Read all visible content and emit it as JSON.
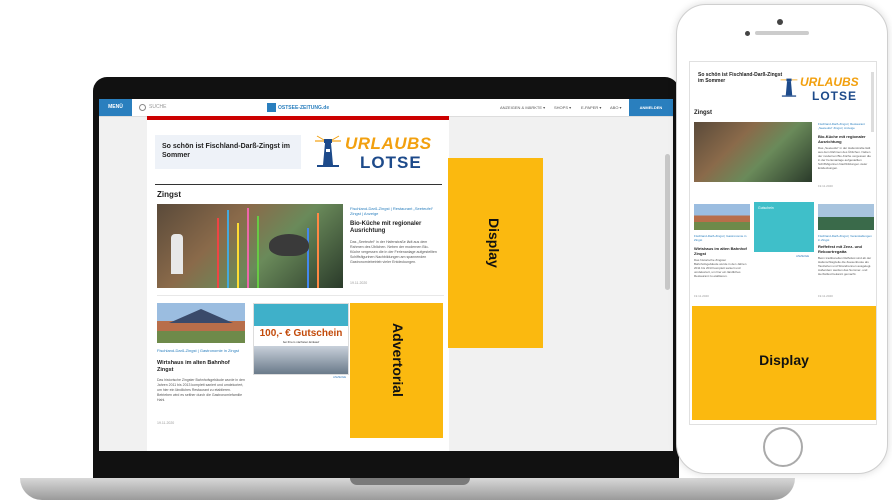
{
  "nav": {
    "menu_label": "MENÜ",
    "search_label": "SUCHE",
    "site_name": "OSTSEE-ZEITUNG.de",
    "links": [
      "ANZEIGEN & MÄRKTE ▾",
      "SHOPS ▾",
      "E-PAPER ▾",
      "ABO ▾"
    ],
    "login_label": "ANMELDEN"
  },
  "banner": {
    "text": "So schön ist Fischland-Darß-Zingst im Sommer",
    "brand_top": "URLAUBS",
    "brand_bottom": "LOTSE"
  },
  "section_title": "Zingst",
  "hero_article": {
    "meta": "Fischland-Darß-Zingst | Restaurant „Seeteufel“ Zingst | Anzeige",
    "title": "Bio-Küche mit regionaler Ausrichtung",
    "text": "Das „Seeteufel“ in der Hafenstraße lädt aus dem Rahmen des Üblichen. Neben der modernen Bio-Küche vergessen die in der Ferienanlage aufgestellten Schiffsfigurinen Nachbildungen am spannenden Gastronomiebetrieb vieler Entdeckungen.",
    "date": "19.11.2020"
  },
  "card1": {
    "meta": "Fischland-Darß-Zingst | Gastronomie in Zingst",
    "title": "Wirtshaus im alten Bahnhof Zingst",
    "text": "Das historische Zingster Bahnhofsgebäude wurde in den Jahren 2011 bis 2013 komplett saniert und umdekoriert, um hier ein ländliches Restaurant zu etablieren. Betrieben wird es seither durch die Gastronomiefamilie Hahl.",
    "date": "19.11.2020"
  },
  "voucher": {
    "label": "100,- € Gutschein",
    "subline": "bei Ihrem nächsten Einkauf",
    "anzeige": "ANZEIGE"
  },
  "labels": {
    "advertorial": "Advertorial",
    "display_laptop": "Display",
    "display_phone": "Display"
  },
  "phone": {
    "banner_text": "So schön ist Fischland-Darß-Zingst im Sommer",
    "brand_top": "URLAUBS",
    "brand_bottom": "LOTSE",
    "section_title": "Zingst",
    "hero_meta": "Fischland-Darß-Zingst | Restaurant „Seeteufel“ Zingst | Anzeige",
    "hero_title": "Bio-Küche mit regionaler Ausrichtung",
    "hero_text": "Das „Seeteufel“ in der Hafenstraße lädt aus dem Rahmen des Üblichen. Neben der modernen Bio-Küche vergessen die in der Ferienanlage aufgestellten Schiffsfigurinen Nachbildungen vieler Entdeckungen.",
    "hero_date": "19.11.2020",
    "teal_label": "Gutschein",
    "anzeige": "ANZEIGE",
    "card1_meta": "Fischland-Darß-Zingst | Gastronomie in Zingst",
    "card1_title": "Wirtshaus im alten Bahnhof Zingst",
    "card1_text": "Das historische Zingster Bahnhofsgebäude wurde in den Jahren 2011 bis 2013 komplett saniert und umdekoriert, um hier ein ländliches Restaurant zu etablieren.",
    "card1_date": "19.11.2020",
    "card3_meta": "Fischland-Darß-Zingst | Veranstaltungen in Zingst",
    "card3_title": "Reffefest mit Zeez- und Rekoortregatta",
    "card3_text": "Beim traditionellen Reffefest sind ab der Hafenschlagzeile die Zeesenboote als Tauziehen und Strandrennen ausgelegt. Außerdem werden das Sommer- und Herbstfest bekannt gemacht.",
    "card3_date": "19.11.2020"
  },
  "colors": {
    "accent": "#2a7fbe",
    "ad_yellow": "#fbb90f",
    "brand_orange": "#f2a00f",
    "brand_navy": "#1d4a8a",
    "voucher_teal": "#3fb0c9"
  }
}
